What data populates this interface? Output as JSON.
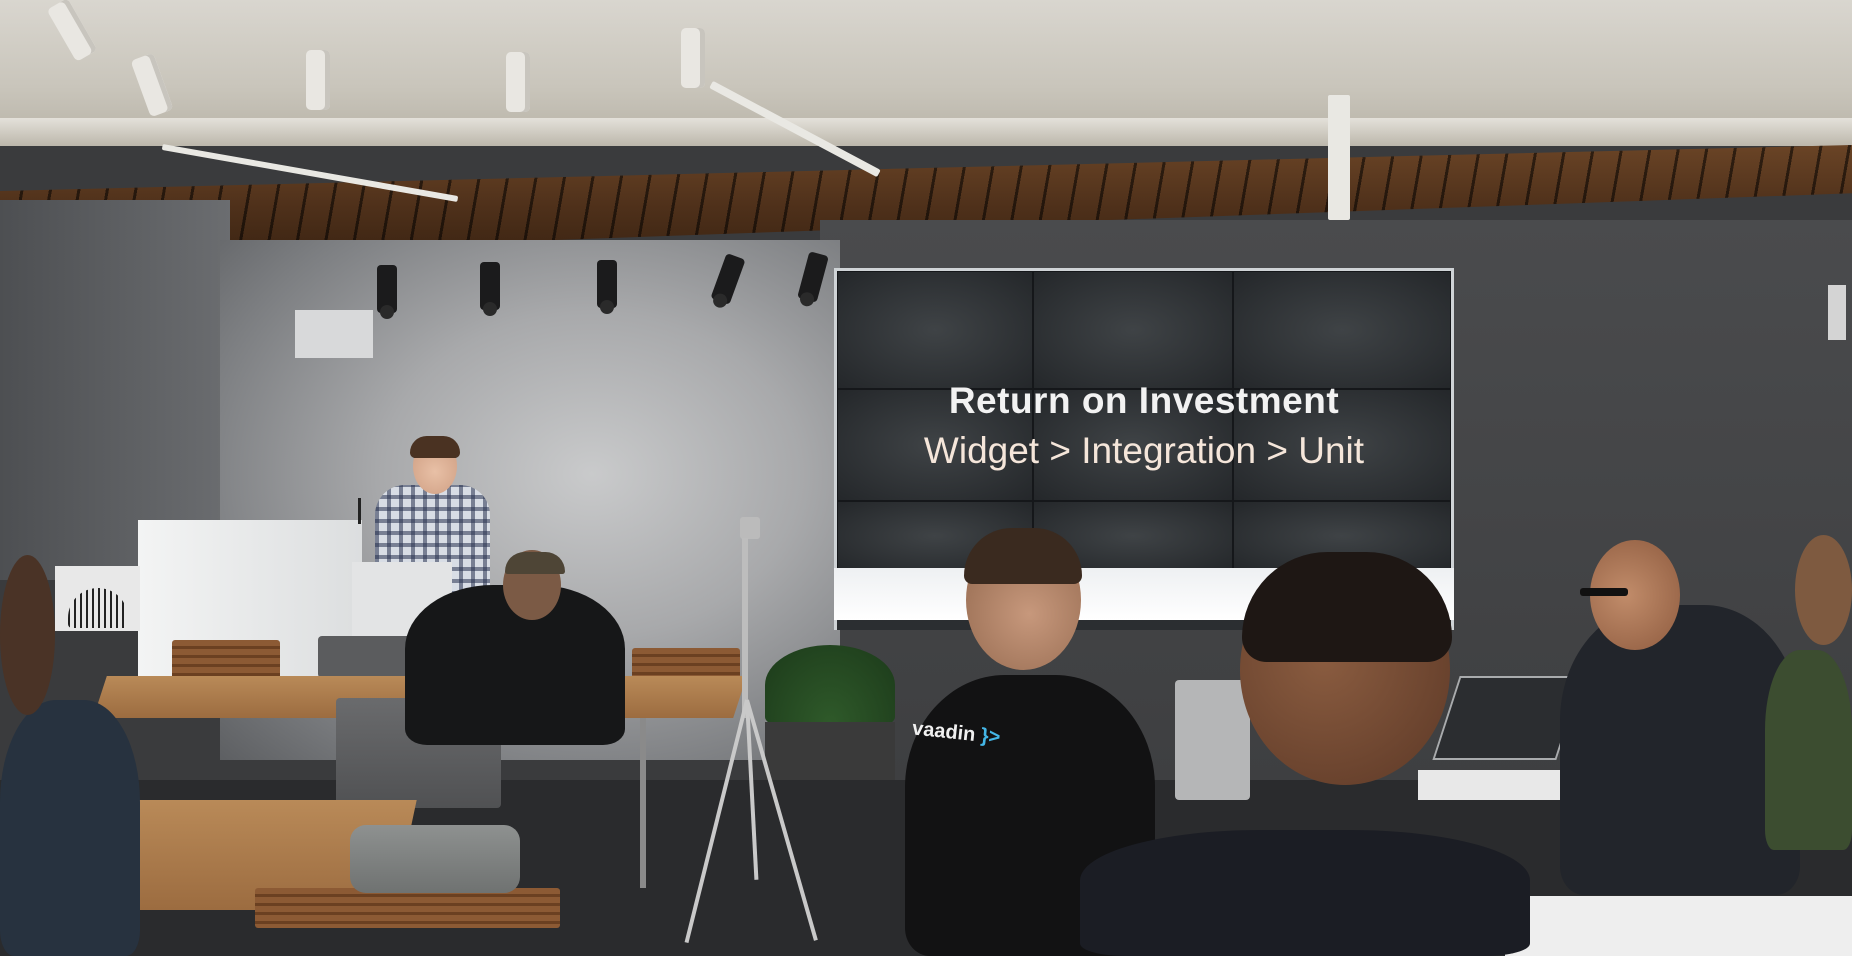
{
  "slide": {
    "title": "Return on Investment",
    "subtitle": "Widget > Integration > Unit"
  },
  "shirt_print": {
    "brand": "vaadin",
    "mark": "}>"
  },
  "colors": {
    "slide_text": "#f2f2f2",
    "slide_subtitle": "#f5e6da",
    "vaadin_arrow": "#44b6e6",
    "wood_ceiling": "#4e301a"
  }
}
